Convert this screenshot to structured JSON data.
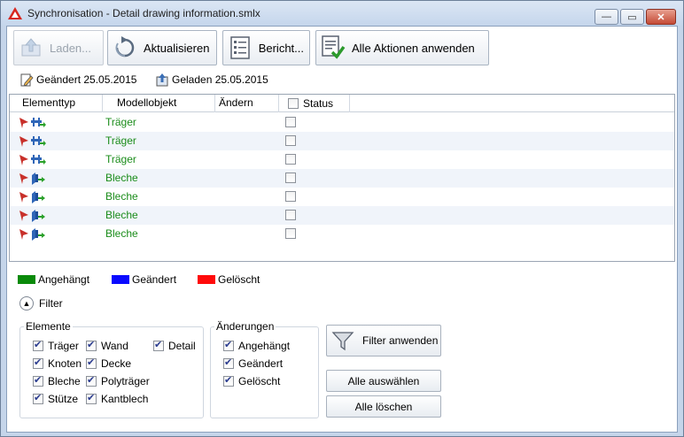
{
  "window": {
    "title": "Synchronisation - Detail drawing information.smlx",
    "min_glyph": "—",
    "max_glyph": "▭",
    "close_glyph": "✕"
  },
  "toolbar": {
    "load_label": "Laden...",
    "refresh_label": "Aktualisieren",
    "report_label": "Bericht...",
    "apply_all_label": "Alle Aktionen anwenden"
  },
  "info": {
    "changed": "Geändert 25.05.2015",
    "loaded": "Geladen 25.05.2015"
  },
  "grid": {
    "columns": [
      "Elementtyp",
      "Modellobjekt",
      "Ändern",
      "Status"
    ],
    "rows": [
      {
        "object": "Träger",
        "icon": "beam-icon"
      },
      {
        "object": "Träger",
        "icon": "beam-icon"
      },
      {
        "object": "Träger",
        "icon": "beam-icon"
      },
      {
        "object": "Bleche",
        "icon": "plate-icon"
      },
      {
        "object": "Bleche",
        "icon": "plate-icon"
      },
      {
        "object": "Bleche",
        "icon": "plate-icon"
      },
      {
        "object": "Bleche",
        "icon": "plate-icon"
      }
    ]
  },
  "legend": {
    "added": {
      "label": "Angehängt",
      "color": "#0a8a0a"
    },
    "changed": {
      "label": "Geändert",
      "color": "#0a0aff"
    },
    "deleted": {
      "label": "Gelöscht",
      "color": "#ff0a0a"
    }
  },
  "filter": {
    "toggle_label": "Filter",
    "elements_title": "Elemente",
    "elements": {
      "traeger": "Träger",
      "wand": "Wand",
      "detail": "Detail",
      "knoten": "Knoten",
      "decke": "Decke",
      "bleche": "Bleche",
      "polytraeger": "Polyträger",
      "stuetze": "Stütze",
      "kantblech": "Kantblech"
    },
    "changes_title": "Änderungen",
    "changes": {
      "added": "Angehängt",
      "changed": "Geändert",
      "deleted": "Gelöscht"
    },
    "apply_label": "Filter anwenden",
    "select_all_label": "Alle auswählen",
    "clear_all_label": "Alle löschen"
  }
}
